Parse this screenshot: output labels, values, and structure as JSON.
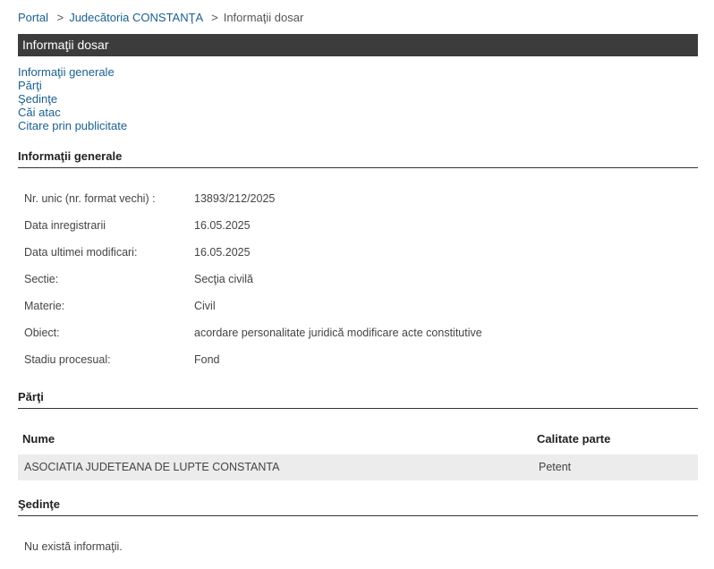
{
  "breadcrumb": {
    "portal": "Portal",
    "separator": ">",
    "court": "Judecătoria CONSTANŢA",
    "current": "Informaţii dosar"
  },
  "title": "Informaţii dosar",
  "nav": {
    "general": "Informaţii generale",
    "parti": "Părţi",
    "sedinte": "Şedinţe",
    "cai_atac": "Căi atac",
    "citare": "Citare prin publicitate"
  },
  "general": {
    "heading": "Informaţii generale",
    "rows": [
      {
        "label": "Nr. unic (nr. format vechi) :",
        "value": "13893/212/2025"
      },
      {
        "label": "Data inregistrarii",
        "value": "16.05.2025"
      },
      {
        "label": "Data ultimei modificari:",
        "value": "16.05.2025"
      },
      {
        "label": "Sectie:",
        "value": "Secţia civilă"
      },
      {
        "label": "Materie:",
        "value": "Civil"
      },
      {
        "label": "Obiect:",
        "value": "acordare personalitate juridică modificare acte constitutive"
      },
      {
        "label": "Stadiu procesual:",
        "value": "Fond"
      }
    ]
  },
  "parti": {
    "heading": "Părţi",
    "columns": {
      "name": "Nume",
      "role": "Calitate parte"
    },
    "rows": [
      {
        "name": "ASOCIATIA JUDETEANA DE LUPTE CONSTANTA",
        "role": "Petent"
      }
    ]
  },
  "sedinte": {
    "heading": "Şedinţe",
    "empty": "Nu există informaţii."
  }
}
